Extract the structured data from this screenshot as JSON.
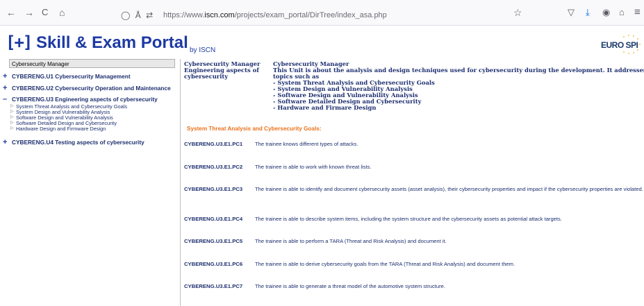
{
  "browser": {
    "back_icon": "←",
    "forward_icon": "→",
    "reload_icon": "C",
    "home_icon": "⌂",
    "shield_icon": "◯",
    "lock_icon": "Å",
    "permissions_icon": "⇄",
    "url_prefix": "https://www.",
    "url_host": "iscn.com",
    "url_path": "/projects/exam_portal/DirTree/index_asa.php",
    "bookmark_icon": "☆",
    "pocket_icon": "▽",
    "download_icon": "⤓",
    "account_icon": "◉",
    "extensions_icon": "⌂",
    "menu_icon": "≡"
  },
  "header": {
    "logo_bracket": "[+]",
    "title": "Skill & Exam Portal",
    "by": "by ISCN",
    "partner_logo": "EURO SPI"
  },
  "sidebar": {
    "heading": "Cybersecurity Manager",
    "units": [
      {
        "symbol": "+",
        "label": "CYBERENG.U1 Cybersecurity Management"
      },
      {
        "symbol": "+",
        "label": "CYBERENG.U2 Cybersecurity Operation and Maintenance"
      },
      {
        "symbol": "–",
        "label": "CYBERENG.U3 Engineering aspects of cybersecurity"
      },
      {
        "symbol": "+",
        "label": "CYBERENG.U4 Testing aspects of cybersecurity"
      }
    ],
    "subitems": [
      "System Threat Analysis and Cybersecurity Goals",
      "System Design and Vulnerability Analysis",
      "Software Design and Vulnerability Analysis",
      "Software Detailed Design and Cybersecurity",
      "Hardware Design and Firmware Design"
    ]
  },
  "main": {
    "crumb_left_title": "Cybersecurity Manager",
    "crumb_left_sub": "Engineering aspects of cybersecurity",
    "crumb_right_title": "Cybersecurity Manager",
    "crumb_right_desc": "This Unit is about the analysis and design techniques used for cybersecurity during the development. It addresses topics such as",
    "crumb_topics": [
      "- System Threat Analysis and Cybersecurity Goals",
      "- System Design and Vulnerability Analysis",
      "- Software Design and Vulnerability Analysis",
      "- Software Detailed Design and Cybersecurity",
      "- Hardware and Firmare Design"
    ],
    "section_heading": "System Threat Analysis and Cybersecurity Goals:",
    "criteria": [
      {
        "code": "CYBERENG.U3.E1.PC1",
        "text": "The trainee knows different types of attacks."
      },
      {
        "code": "CYBERENG.U3.E1.PC2",
        "text": "The trainee is able to work with known threat lists."
      },
      {
        "code": "CYBERENG.U3.E1.PC3",
        "text": "The trainee is able to identify and document cybersecurity assets (asset analysis), their cybersecurity properties and impact if the cybersecurity properties are violated."
      },
      {
        "code": "CYBERENG.U3.E1.PC4",
        "text": "The trainee is able to describe system items, including the system structure and the cybersecurity assets as potential attack targets."
      },
      {
        "code": "CYBERENG.U3.E1.PC5",
        "text": "The trainee is able to perform a TARA (Threat and Risk Analysis) and document it."
      },
      {
        "code": "CYBERENG.U3.E1.PC6",
        "text": "The trainee is able to derive cybersecurity goals from the TARA (Threat and Risk Analysis) and document them."
      },
      {
        "code": "CYBERENG.U3.E1.PC7",
        "text": "The trainee is able to generate a threat model of the automotive system structure."
      }
    ]
  }
}
